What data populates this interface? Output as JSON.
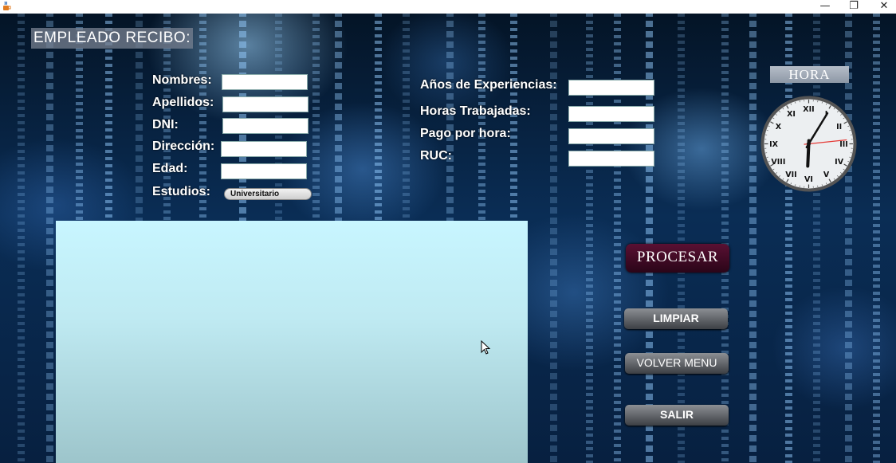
{
  "window": {
    "icon": "java-cup-icon",
    "controls": {
      "minimize": "—",
      "restore": "❐",
      "close": "✕"
    }
  },
  "heading": "EMPLEADO RECIBO:",
  "left_form": {
    "nombres_label": "Nombres:",
    "nombres_value": "",
    "apellidos_label": "Apellidos:",
    "apellidos_value": "",
    "dni_label": "DNI:",
    "dni_value": "",
    "direccion_label": "Dirección:",
    "direccion_value": "",
    "edad_label": "Edad:",
    "edad_value": "",
    "estudios_label": "Estudios:",
    "estudios_selected": "Universitario"
  },
  "right_form": {
    "anios_label": "Años de Experiencias:",
    "anios_value": "",
    "horas_label": "Horas Trabajadas:",
    "horas_value": "",
    "pago_label": "Pago por hora:",
    "pago_value": "",
    "ruc_label": "RUC:",
    "ruc_value": ""
  },
  "output_area": {
    "text": ""
  },
  "clock": {
    "label": "HORA",
    "numerals": [
      "XII",
      "I",
      "II",
      "III",
      "IV",
      "V",
      "VI",
      "VII",
      "VIII",
      "IX",
      "X",
      "XI"
    ],
    "time": {
      "hour": 6,
      "minute": 5,
      "second": 14
    },
    "second_hand_color": "#e53935"
  },
  "buttons": {
    "procesar": "PROCESAR",
    "limpiar": "LIMPIAR",
    "volver_menu": "VOLVER MENU",
    "salir": "SALIR"
  },
  "colors": {
    "procesar_bg": "#4a0c2a",
    "textarea_top": "#c8f6ff",
    "textarea_bottom": "#9dc5cb"
  }
}
